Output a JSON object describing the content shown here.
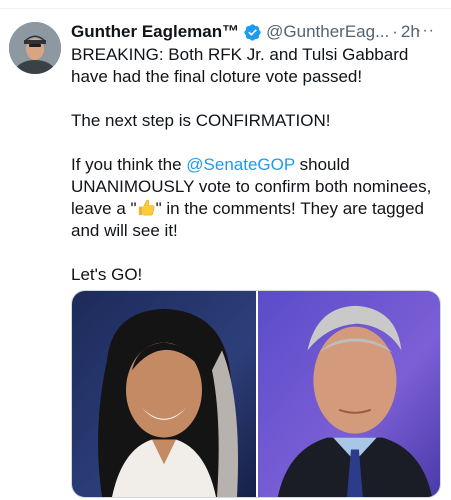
{
  "tweet": {
    "author_name": "Gunther Eagleman™",
    "handle": "@GuntherEag...",
    "separator": "·",
    "timestamp": "2h",
    "more_label": "···",
    "line1": "BREAKING: Both RFK Jr. and Tulsi Gabbard have had the final cloture vote passed!",
    "line2": "The next step is CONFIRMATION!",
    "line3_before": "If you think the ",
    "line3_mention": "@SenateGOP",
    "line3_after": " should UNANIMOUSLY vote to confirm both nominees, leave a \"",
    "line3_end": "\" in the comments! They are tagged and will see it!",
    "line4": "Let's GO!"
  },
  "colors": {
    "verified_badge": "#1d9bf0",
    "mention": "#1d9bf0",
    "secondary_text": "#536471"
  },
  "icons": {
    "verified": "verified-badge-icon",
    "emoji": "thumbs-up-emoji",
    "more": "more-options-icon"
  }
}
